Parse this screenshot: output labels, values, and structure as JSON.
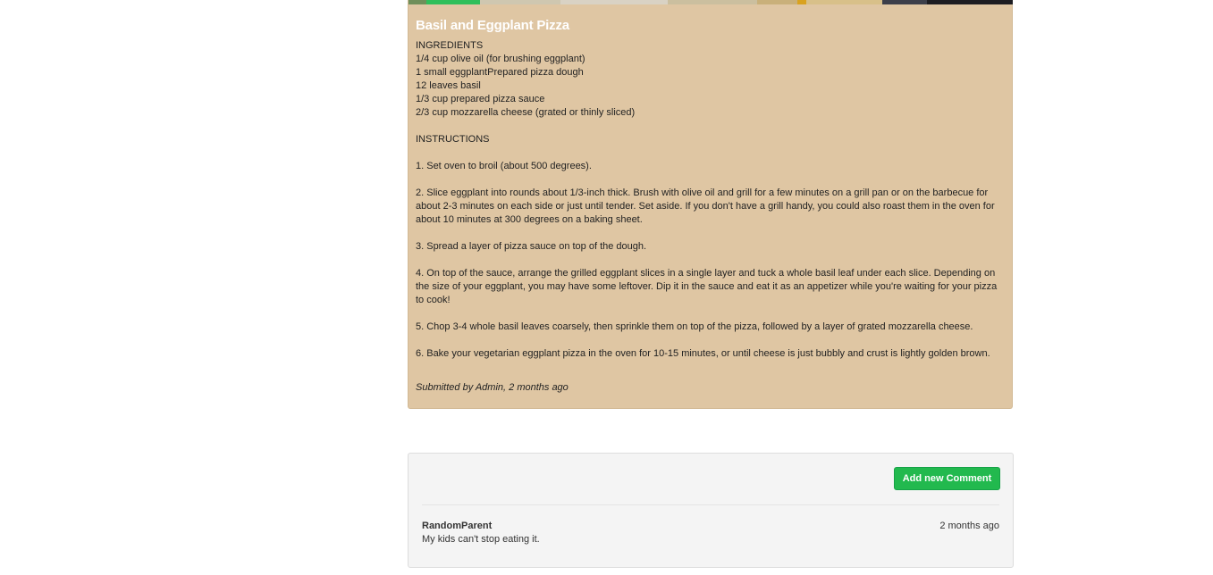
{
  "recipe": {
    "title": "Basil and Eggplant Pizza",
    "body": "INGREDIENTS\n1/4 cup olive oil (for brushing eggplant)\n1 small eggplantPrepared pizza dough\n12 leaves basil\n1/3 cup prepared pizza sauce\n2/3 cup mozzarella cheese (grated or thinly sliced)\n\nINSTRUCTIONS\n\n1. Set oven to broil (about 500 degrees).\n\n2. Slice eggplant into rounds about 1/3-inch thick. Brush with olive oil and grill for a few minutes on a grill pan or on the barbecue for about 2-3 minutes on each side or just until tender. Set aside. If you don't have a grill handy, you could also roast them in the oven for about 10 minutes at 300 degrees on a baking sheet.\n\n3. Spread a layer of pizza sauce on top of the dough.\n\n4. On top of the sauce, arrange the grilled eggplant slices in a single layer and tuck a whole basil leaf under each slice. Depending on the size of your eggplant, you may have some leftover. Dip it in the sauce and eat it as an appetizer while you're waiting for your pizza to cook!\n\n5. Chop 3-4 whole basil leaves coarsely, then sprinkle them on top of the pizza, followed by a layer of grated mozzarella cheese.\n\n6. Bake your vegetarian eggplant pizza in the oven for 10-15 minutes, or until cheese is just bubbly and crust is lightly golden brown.",
    "submitted": "Submitted by Admin, 2 months ago"
  },
  "comments": {
    "add_button_label": "Add new Comment",
    "items": [
      {
        "author": "RandomParent",
        "time": "2 months ago",
        "text": "My kids can't stop eating it."
      }
    ]
  },
  "colors": {
    "card_background": "#dfc6a3",
    "title_text": "#ffffff",
    "add_button": "#22b94e",
    "panel_background": "#f4f4f4"
  }
}
